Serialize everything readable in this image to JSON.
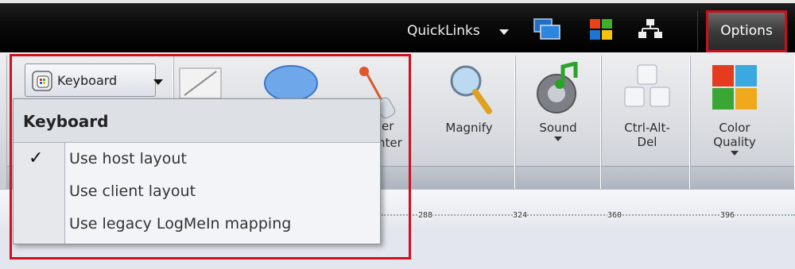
{
  "topbar": {
    "quicklinks_label": "QuickLinks",
    "options_label": "Options"
  },
  "ribbon": {
    "magnify_label": "Magnify",
    "sound_label": "Sound",
    "ctrl_alt_del_line1": "Ctrl-Alt-",
    "ctrl_alt_del_line2": "Del",
    "color_quality_line1": "Color",
    "color_quality_line2": "Quality",
    "partial_label_1": "er",
    "partial_label_2": "nter"
  },
  "keyboard": {
    "tab_label": "Keyboard",
    "menu_title": "Keyboard",
    "items": [
      {
        "label": "Use host layout",
        "checked": true
      },
      {
        "label": "Use client layout",
        "checked": false
      },
      {
        "label": "Use legacy LogMeIn mapping",
        "checked": false
      }
    ]
  },
  "ruler": {
    "ticks": [
      "288",
      "324",
      "360",
      "396"
    ]
  },
  "colors": {
    "highlight_red": "#d0101c",
    "topbar": "#0b0b0b",
    "ribbon": "#d8dbe0"
  }
}
